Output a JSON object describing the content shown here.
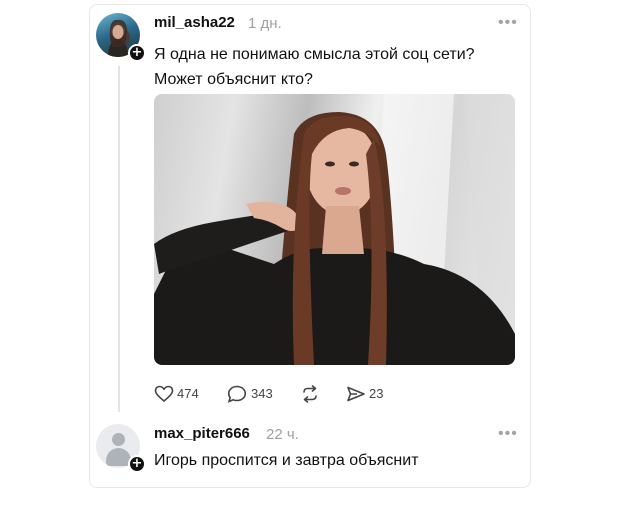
{
  "post": {
    "username": "mil_asha22",
    "time": "1 дн.",
    "more": "•••",
    "text": "Я одна не понимаю смысла этой соц сети? Может объяснит кто?",
    "photo_icon": "selfie-photo",
    "actions": {
      "likes": "474",
      "comments": "343",
      "shares": "23"
    }
  },
  "reply": {
    "username": "max_piter666",
    "time": "22 ч.",
    "more": "•••",
    "text": "Игорь проспится и завтра объяснит"
  },
  "colors": {
    "text": "#111111",
    "muted": "#a0a0a0",
    "border": "#e7e7e7"
  }
}
